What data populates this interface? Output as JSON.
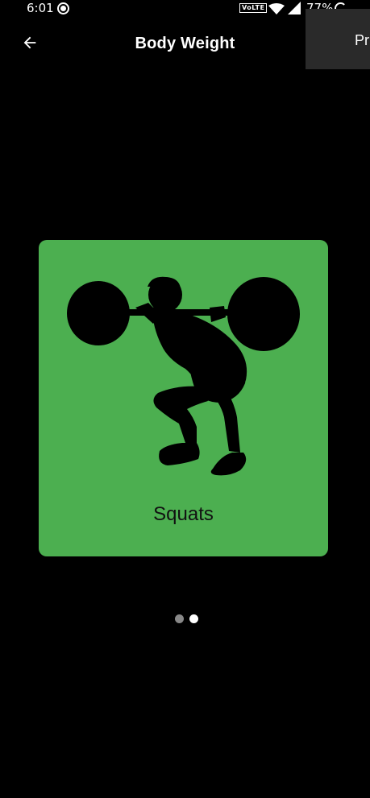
{
  "status_bar": {
    "time": "6:01",
    "volte": "VoLTE",
    "battery": "77%",
    "icons": [
      "record-icon",
      "wifi-icon",
      "signal-icon",
      "battery-ring-icon"
    ]
  },
  "app_bar": {
    "title": "Body Weight",
    "back_icon": "arrow-left-icon",
    "menu_item": "Pr"
  },
  "card": {
    "label": "Squats",
    "image": "squat-silhouette",
    "color": "#4caf50"
  },
  "pager": {
    "count": 2,
    "active_index": 1
  },
  "colors": {
    "background": "#000000",
    "accent": "#4caf50",
    "dot_inactive": "#888888",
    "dot_active": "#ffffff"
  }
}
